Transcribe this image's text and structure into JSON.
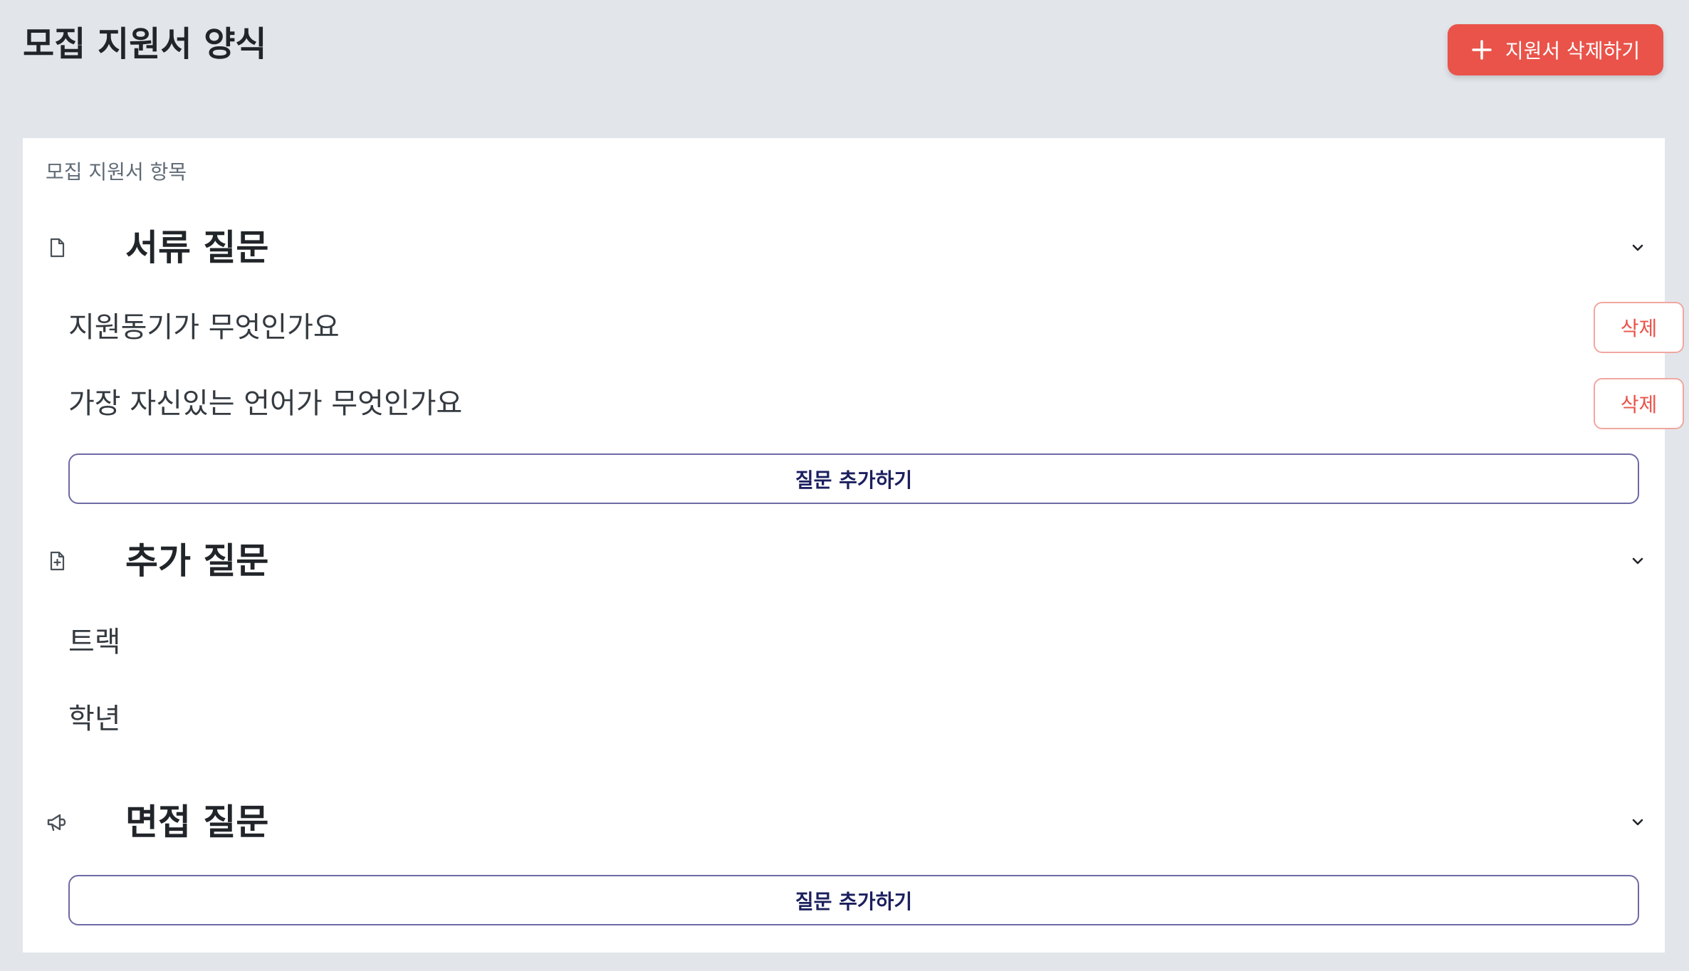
{
  "page": {
    "title": "모집 지원서 양식",
    "delete_form_label": "지원서 삭제하기"
  },
  "card": {
    "label": "모집 지원서 항목"
  },
  "sections": [
    {
      "title": "서류 질문",
      "icon": "document-icon",
      "questions": [
        {
          "text": "지원동기가 무엇인가요",
          "delete_label": "삭제"
        },
        {
          "text": "가장 자신있는 언어가 무엇인가요",
          "delete_label": "삭제"
        }
      ],
      "add_label": "질문 추가하기"
    },
    {
      "title": "추가 질문",
      "icon": "document-add-icon",
      "items": [
        "트랙",
        "학년"
      ]
    },
    {
      "title": "면접 질문",
      "icon": "megaphone-icon",
      "add_label": "질문 추가하기"
    }
  ],
  "colors": {
    "background": "#e2e6ea",
    "danger": "#e9534a",
    "add_border": "#6e6aa5",
    "add_text": "#1b1f5e"
  }
}
